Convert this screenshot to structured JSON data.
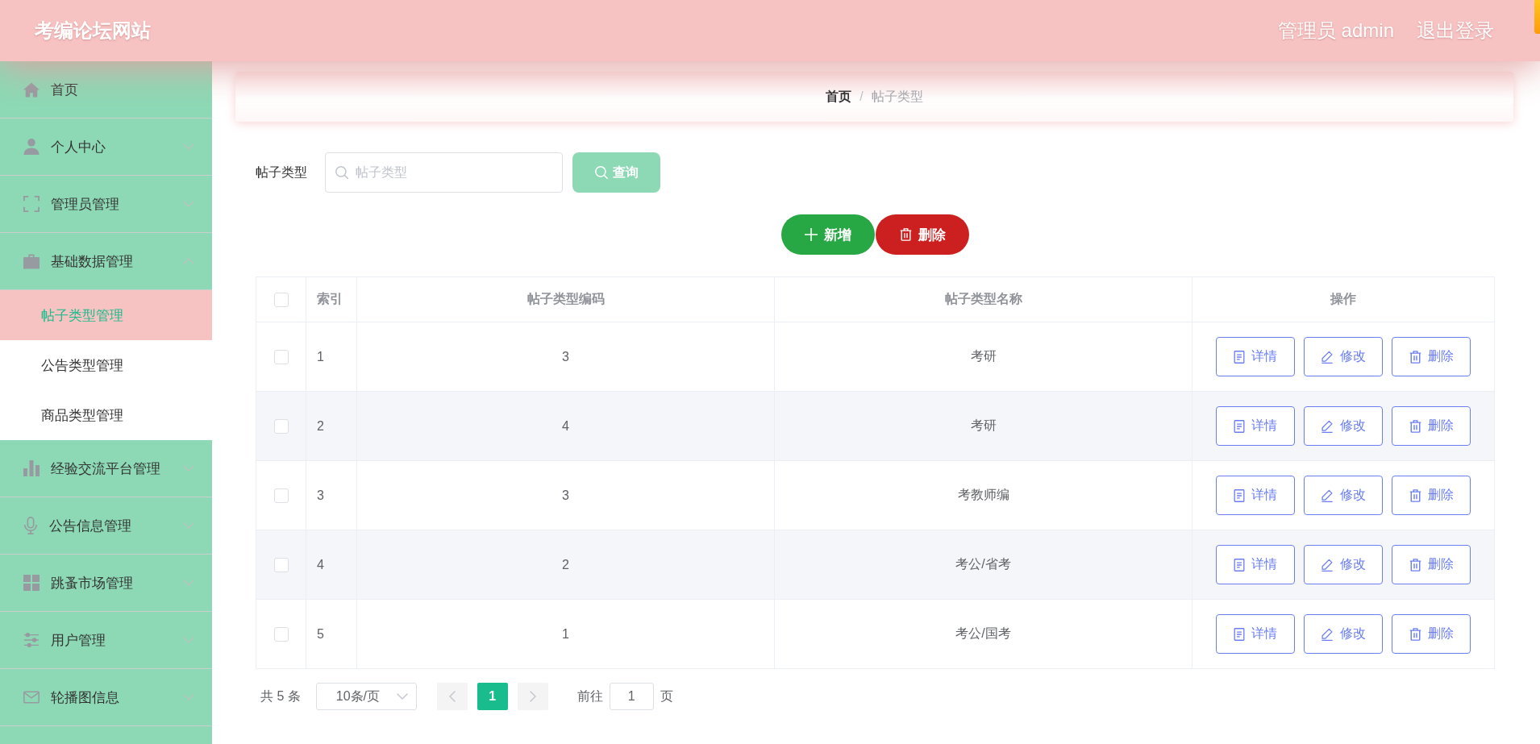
{
  "header": {
    "title": "考编论坛网站",
    "user": "管理员 admin",
    "logout": "退出登录"
  },
  "sidebar": {
    "items": [
      {
        "label": "首页",
        "kind": "link"
      },
      {
        "label": "个人中心",
        "kind": "menu",
        "expanded": false
      },
      {
        "label": "管理员管理",
        "kind": "menu",
        "expanded": false
      },
      {
        "label": "基础数据管理",
        "kind": "menu",
        "expanded": true,
        "children": [
          {
            "label": "帖子类型管理",
            "selected": true
          },
          {
            "label": "公告类型管理",
            "selected": false
          },
          {
            "label": "商品类型管理",
            "selected": false
          }
        ]
      },
      {
        "label": "经验交流平台管理",
        "kind": "menu",
        "expanded": false
      },
      {
        "label": "公告信息管理",
        "kind": "menu",
        "expanded": false
      },
      {
        "label": "跳蚤市场管理",
        "kind": "menu",
        "expanded": false
      },
      {
        "label": "用户管理",
        "kind": "menu",
        "expanded": false
      },
      {
        "label": "轮播图信息",
        "kind": "menu",
        "expanded": false
      }
    ]
  },
  "breadcrumb": {
    "separator": "/",
    "items": [
      {
        "label": "首页",
        "current": false
      },
      {
        "label": "帖子类型",
        "current": true
      }
    ]
  },
  "search": {
    "label": "帖子类型",
    "placeholder": "帖子类型",
    "button": "查询"
  },
  "actions": [
    {
      "label": "新增",
      "kind": "add"
    },
    {
      "label": "删除",
      "kind": "delete"
    }
  ],
  "table": {
    "select_all": false,
    "columns": [
      "索引",
      "帖子类型编码",
      "帖子类型名称",
      "操作"
    ],
    "rows": [
      {
        "checked": false,
        "index": "1",
        "code": "3",
        "name": "考研",
        "actions": [
          {
            "label": "详情",
            "kind": "view"
          },
          {
            "label": "修改",
            "kind": "edit"
          },
          {
            "label": "删除",
            "kind": "delete"
          }
        ]
      },
      {
        "checked": false,
        "index": "2",
        "code": "4",
        "name": "考研",
        "actions": [
          {
            "label": "详情",
            "kind": "view"
          },
          {
            "label": "修改",
            "kind": "edit"
          },
          {
            "label": "删除",
            "kind": "delete"
          }
        ]
      },
      {
        "checked": false,
        "index": "3",
        "code": "3",
        "name": "考教师编",
        "actions": [
          {
            "label": "详情",
            "kind": "view"
          },
          {
            "label": "修改",
            "kind": "edit"
          },
          {
            "label": "删除",
            "kind": "delete"
          }
        ]
      },
      {
        "checked": false,
        "index": "4",
        "code": "2",
        "name": "考公/省考",
        "actions": [
          {
            "label": "详情",
            "kind": "view"
          },
          {
            "label": "修改",
            "kind": "edit"
          },
          {
            "label": "删除",
            "kind": "delete"
          }
        ]
      },
      {
        "checked": false,
        "index": "5",
        "code": "1",
        "name": "考公/国考",
        "actions": [
          {
            "label": "详情",
            "kind": "view"
          },
          {
            "label": "修改",
            "kind": "edit"
          },
          {
            "label": "删除",
            "kind": "delete"
          }
        ]
      }
    ]
  },
  "pagination": {
    "total": "共 5 条",
    "page_size": "10条/页",
    "prev_disabled": true,
    "next_disabled": true,
    "pages": [
      {
        "label": "1",
        "selected": true
      }
    ],
    "goto_label": "前往",
    "goto_value": "1",
    "goto_suffix": "页"
  }
}
